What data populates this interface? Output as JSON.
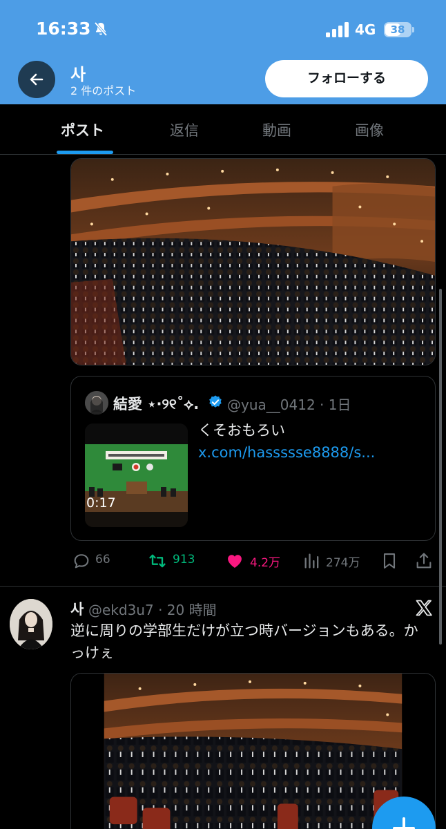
{
  "status_bar": {
    "time": "16:33",
    "network": "4G",
    "battery": "38",
    "icons": [
      "bell-muted-icon",
      "signal-bars-icon",
      "battery-icon"
    ]
  },
  "header": {
    "name": "사",
    "post_count": "2 件のポスト",
    "follow_label": "フォローする"
  },
  "tabs": [
    {
      "label": "ポスト",
      "active": true
    },
    {
      "label": "返信",
      "active": false
    },
    {
      "label": "動画",
      "active": false
    },
    {
      "label": "画像",
      "active": false
    }
  ],
  "quote": {
    "name": "結愛 ⋆·୨୧˚⟡.",
    "handle": "@yua__0412 · 1日",
    "text": "くそおもろい ",
    "link": "x.com/hassssse8888/s...",
    "video_duration": "0:17"
  },
  "post1_actions": {
    "replies": "66",
    "reposts": "913",
    "likes": "4.2万",
    "views": "274万",
    "colors": {
      "repost": "#00ba7c",
      "like": "#f91880",
      "muted": "#71767b"
    }
  },
  "post2": {
    "name": "사",
    "handle": "@ekd3u7 · 20 時間",
    "text": "逆に周りの学部生だけが立つ時バージョンもある。かっけぇ"
  },
  "colors": {
    "accent": "#1d9bf0",
    "header_bg": "#4d9de6"
  }
}
